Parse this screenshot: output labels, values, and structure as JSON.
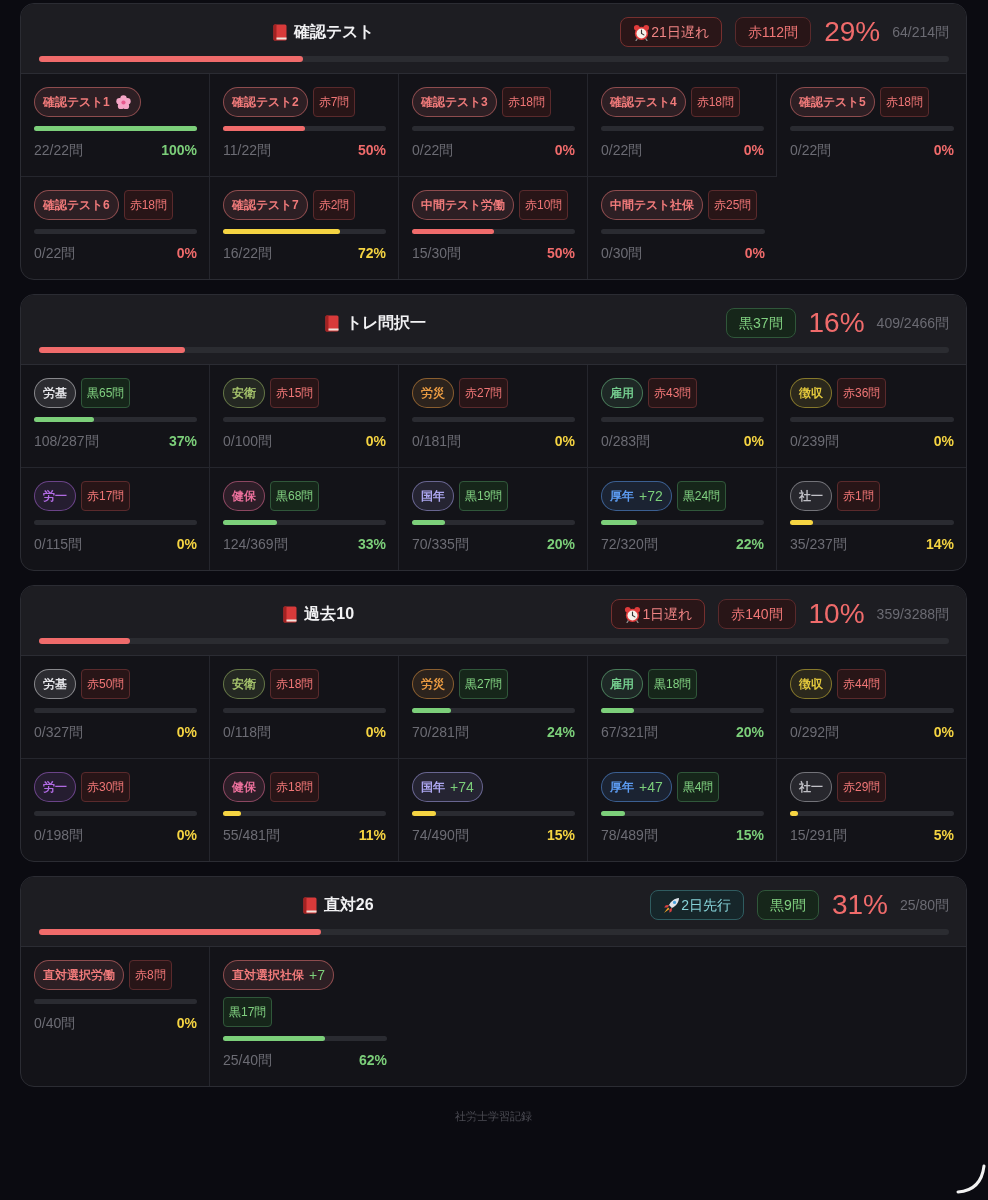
{
  "sections": [
    {
      "title": "確認テスト",
      "badges": [
        {
          "kind": "late",
          "text": "21日遅れ"
        },
        {
          "kind": "red",
          "text": "赤112問"
        }
      ],
      "percent": "29%",
      "count": "64/214問",
      "level": 0.29,
      "items": [
        {
          "completed": true,
          "tag": {
            "label": "確認テスト1",
            "color": "#f07a7a"
          },
          "progress": {
            "level": 1,
            "color": "#7ccf7a",
            "count": "22/22問",
            "percent": "100%"
          }
        },
        {
          "completed": false,
          "tag": {
            "label": "確認テスト2",
            "color": "#f07a7a"
          },
          "badge": {
            "kind": "red",
            "text": "赤7問"
          },
          "progress": {
            "level": 0.5,
            "color": "#f06b6b",
            "count": "11/22問",
            "percent": "50%"
          }
        },
        {
          "completed": false,
          "tag": {
            "label": "確認テスト3",
            "color": "#f07a7a"
          },
          "badge": {
            "kind": "red",
            "text": "赤18問"
          },
          "progress": {
            "level": 0,
            "color": "#f06b6b",
            "count": "0/22問",
            "percent": "0%"
          }
        },
        {
          "completed": false,
          "tag": {
            "label": "確認テスト4",
            "color": "#f07a7a"
          },
          "badge": {
            "kind": "red",
            "text": "赤18問"
          },
          "progress": {
            "level": 0,
            "color": "#f06b6b",
            "count": "0/22問",
            "percent": "0%"
          }
        },
        {
          "completed": false,
          "tag": {
            "label": "確認テスト5",
            "color": "#f07a7a"
          },
          "badge": {
            "kind": "red",
            "text": "赤18問"
          },
          "progress": {
            "level": 0,
            "color": "#f06b6b",
            "count": "0/22問",
            "percent": "0%"
          }
        },
        {
          "completed": false,
          "tag": {
            "label": "確認テスト6",
            "color": "#f07a7a"
          },
          "badge": {
            "kind": "red",
            "text": "赤18問"
          },
          "progress": {
            "level": 0,
            "color": "#f06b6b",
            "count": "0/22問",
            "percent": "0%"
          }
        },
        {
          "completed": false,
          "tag": {
            "label": "確認テスト7",
            "color": "#f07a7a"
          },
          "badge": {
            "kind": "red",
            "text": "赤2問"
          },
          "progress": {
            "level": 0.72,
            "color": "#f5d442",
            "count": "16/22問",
            "percent": "72%"
          }
        },
        {
          "completed": false,
          "tag": {
            "label": "中間テスト労働",
            "color": "#f07a7a"
          },
          "badge": {
            "kind": "red",
            "text": "赤10問"
          },
          "progress": {
            "level": 0.5,
            "color": "#f06b6b",
            "count": "15/30問",
            "percent": "50%"
          }
        },
        {
          "completed": false,
          "tag": {
            "label": "中間テスト社保",
            "color": "#f07a7a"
          },
          "badge": {
            "kind": "red",
            "text": "赤25問"
          },
          "progress": {
            "level": 0,
            "color": "#f06b6b",
            "count": "0/30問",
            "percent": "0%"
          }
        }
      ]
    },
    {
      "title": "トレ問択一",
      "badges": [
        {
          "kind": "green",
          "text": "黒37問"
        }
      ],
      "percent": "16%",
      "count": "409/2466問",
      "level": 0.16,
      "items": [
        {
          "completed": false,
          "tag": {
            "label": "労基",
            "color": "#e4e4e8"
          },
          "badge": {
            "kind": "green",
            "text": "黒65問"
          },
          "progress": {
            "level": 0.37,
            "color": "#7ccf7a",
            "count": "108/287問",
            "percent": "37%"
          }
        },
        {
          "completed": false,
          "tag": {
            "label": "安衛",
            "color": "#a6c46c"
          },
          "badge": {
            "kind": "red",
            "text": "赤15問"
          },
          "progress": {
            "level": 0,
            "color": "#f5d442",
            "count": "0/100問",
            "percent": "0%"
          }
        },
        {
          "completed": false,
          "tag": {
            "label": "労災",
            "color": "#e89a42"
          },
          "badge": {
            "kind": "red",
            "text": "赤27問"
          },
          "progress": {
            "level": 0,
            "color": "#f5d442",
            "count": "0/181問",
            "percent": "0%"
          }
        },
        {
          "completed": false,
          "tag": {
            "label": "雇用",
            "color": "#72c98c"
          },
          "badge": {
            "kind": "red",
            "text": "赤43問"
          },
          "progress": {
            "level": 0,
            "color": "#f5d442",
            "count": "0/283問",
            "percent": "0%"
          }
        },
        {
          "completed": false,
          "tag": {
            "label": "徴収",
            "color": "#e2c83c"
          },
          "badge": {
            "kind": "red",
            "text": "赤36問"
          },
          "progress": {
            "level": 0,
            "color": "#f5d442",
            "count": "0/239問",
            "percent": "0%"
          }
        },
        {
          "completed": false,
          "tag": {
            "label": "労一",
            "color": "#b06ae2"
          },
          "badge": {
            "kind": "red",
            "text": "赤17問"
          },
          "progress": {
            "level": 0,
            "color": "#f5d442",
            "count": "0/115問",
            "percent": "0%"
          }
        },
        {
          "completed": false,
          "tag": {
            "label": "健保",
            "color": "#ec709c"
          },
          "badge": {
            "kind": "green",
            "text": "黒68問"
          },
          "progress": {
            "level": 0.33,
            "color": "#7ccf7a",
            "count": "124/369問",
            "percent": "33%"
          }
        },
        {
          "completed": false,
          "tag": {
            "label": "国年",
            "color": "#aca6f0"
          },
          "badge": {
            "kind": "green",
            "text": "黒19問"
          },
          "progress": {
            "level": 0.2,
            "color": "#7ccf7a",
            "count": "70/335問",
            "percent": "20%"
          }
        },
        {
          "completed": false,
          "tag": {
            "label": "厚年",
            "extra": "+72",
            "color": "#5c9cf2"
          },
          "badge": {
            "kind": "green",
            "text": "黒24問"
          },
          "progress": {
            "level": 0.22,
            "color": "#7ccf7a",
            "count": "72/320問",
            "percent": "22%"
          }
        },
        {
          "completed": false,
          "tag": {
            "label": "社一",
            "color": "#c0c0c6"
          },
          "badge": {
            "kind": "red",
            "text": "赤1問"
          },
          "progress": {
            "level": 0.14,
            "color": "#f5d442",
            "count": "35/237問",
            "percent": "14%"
          }
        }
      ]
    },
    {
      "title": "過去10",
      "badges": [
        {
          "kind": "late",
          "text": "1日遅れ"
        },
        {
          "kind": "red",
          "text": "赤140問"
        }
      ],
      "percent": "10%",
      "count": "359/3288問",
      "level": 0.1,
      "items": [
        {
          "completed": false,
          "tag": {
            "label": "労基",
            "color": "#e4e4e8"
          },
          "badge": {
            "kind": "red",
            "text": "赤50問"
          },
          "progress": {
            "level": 0,
            "color": "#f5d442",
            "count": "0/327問",
            "percent": "0%"
          }
        },
        {
          "completed": false,
          "tag": {
            "label": "安衛",
            "color": "#a6c46c"
          },
          "badge": {
            "kind": "red",
            "text": "赤18問"
          },
          "progress": {
            "level": 0,
            "color": "#f5d442",
            "count": "0/118問",
            "percent": "0%"
          }
        },
        {
          "completed": false,
          "tag": {
            "label": "労災",
            "color": "#e89a42"
          },
          "badge": {
            "kind": "green",
            "text": "黒27問"
          },
          "progress": {
            "level": 0.24,
            "color": "#7ccf7a",
            "count": "70/281問",
            "percent": "24%"
          }
        },
        {
          "completed": false,
          "tag": {
            "label": "雇用",
            "color": "#72c98c"
          },
          "badge": {
            "kind": "green",
            "text": "黒18問"
          },
          "progress": {
            "level": 0.2,
            "color": "#7ccf7a",
            "count": "67/321問",
            "percent": "20%"
          }
        },
        {
          "completed": false,
          "tag": {
            "label": "徴収",
            "color": "#e2c83c"
          },
          "badge": {
            "kind": "red",
            "text": "赤44問"
          },
          "progress": {
            "level": 0,
            "color": "#f5d442",
            "count": "0/292問",
            "percent": "0%"
          }
        },
        {
          "completed": false,
          "tag": {
            "label": "労一",
            "color": "#b06ae2"
          },
          "badge": {
            "kind": "red",
            "text": "赤30問"
          },
          "progress": {
            "level": 0,
            "color": "#f5d442",
            "count": "0/198問",
            "percent": "0%"
          }
        },
        {
          "completed": false,
          "tag": {
            "label": "健保",
            "color": "#ec709c"
          },
          "badge": {
            "kind": "red",
            "text": "赤18問"
          },
          "progress": {
            "level": 0.11,
            "color": "#f5d442",
            "count": "55/481問",
            "percent": "11%"
          }
        },
        {
          "completed": false,
          "tag": {
            "label": "国年",
            "extra": "+74",
            "color": "#aca6f0"
          },
          "progress": {
            "level": 0.15,
            "color": "#f5d442",
            "count": "74/490問",
            "percent": "15%"
          }
        },
        {
          "completed": false,
          "tag": {
            "label": "厚年",
            "extra": "+47",
            "color": "#5c9cf2"
          },
          "badge": {
            "kind": "green",
            "text": "黒4問"
          },
          "progress": {
            "level": 0.15,
            "color": "#7ccf7a",
            "count": "78/489問",
            "percent": "15%"
          }
        },
        {
          "completed": false,
          "tag": {
            "label": "社一",
            "color": "#c0c0c6"
          },
          "badge": {
            "kind": "red",
            "text": "赤29問"
          },
          "progress": {
            "level": 0.05,
            "color": "#f5d442",
            "count": "15/291問",
            "percent": "5%"
          }
        }
      ]
    },
    {
      "title": "直対26",
      "badges": [
        {
          "kind": "ahead",
          "text": "2日先行"
        },
        {
          "kind": "green",
          "text": "黒9問"
        }
      ],
      "percent": "31%",
      "count": "25/80問",
      "level": 0.31,
      "items": [
        {
          "completed": false,
          "tag": {
            "label": "直対選択労働",
            "color": "#f07a7a"
          },
          "badge": {
            "kind": "red",
            "text": "赤8問"
          },
          "progress": {
            "level": 0,
            "color": "#f5d442",
            "count": "0/40問",
            "percent": "0%"
          }
        },
        {
          "completed": false,
          "tag": {
            "label": "直対選択社保",
            "extra": "+7",
            "color": "#f07a7a"
          },
          "badge": {
            "kind": "green",
            "text": "黒17問"
          },
          "progress": {
            "level": 0.62,
            "color": "#7ccf7a",
            "count": "25/40問",
            "percent": "62%"
          }
        }
      ]
    }
  ],
  "footer": "社労士学習記録"
}
